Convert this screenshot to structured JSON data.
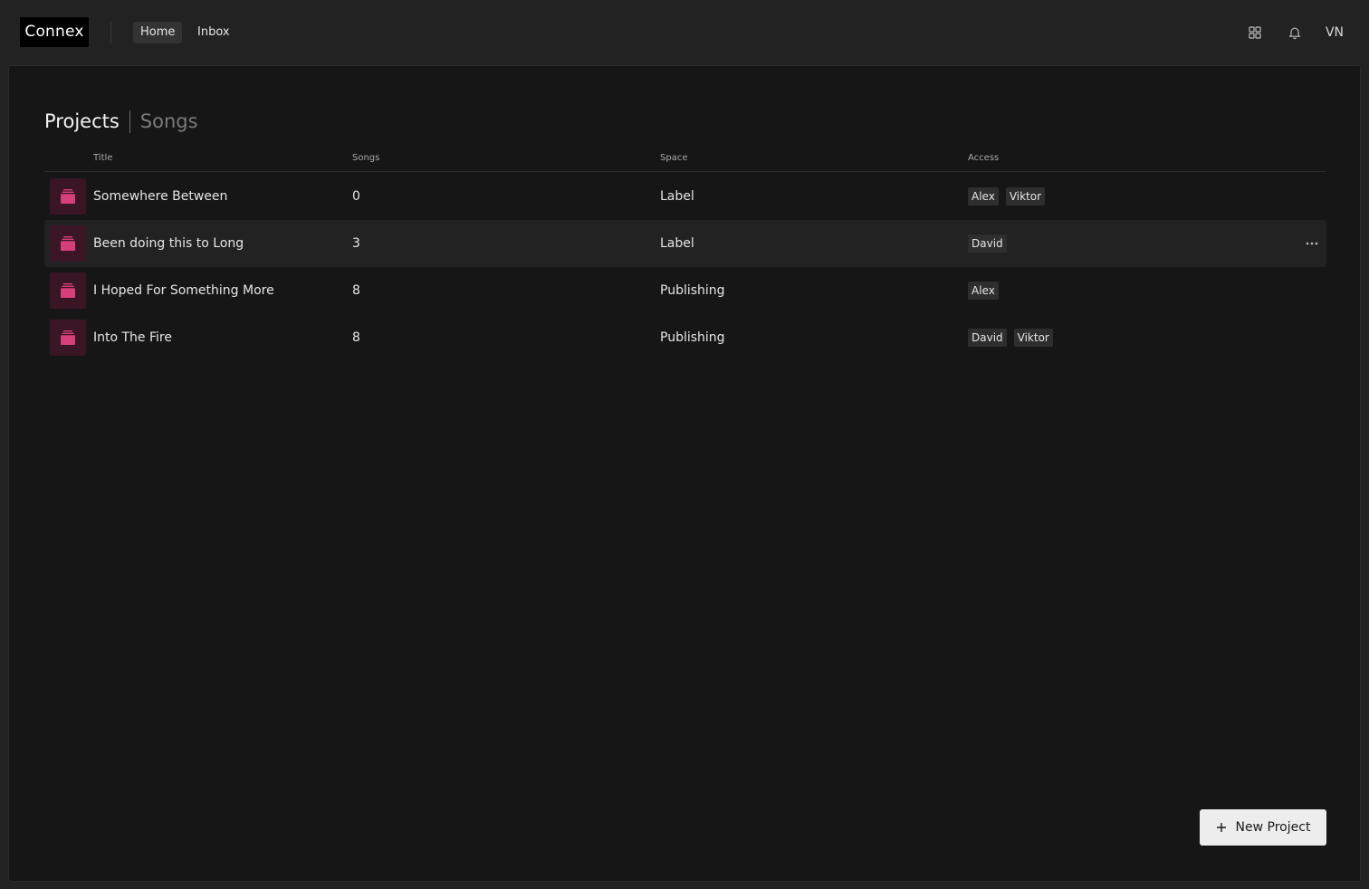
{
  "app": {
    "logo": "Connex"
  },
  "nav": [
    {
      "label": "Home",
      "active": true
    },
    {
      "label": "Inbox",
      "active": false
    }
  ],
  "header_icons": [
    "grid-icon",
    "bell-icon"
  ],
  "user": {
    "initials": "VN"
  },
  "tabs": [
    {
      "label": "Projects",
      "active": true
    },
    {
      "label": "Songs",
      "active": false
    }
  ],
  "table": {
    "columns": [
      "Title",
      "Songs",
      "Space",
      "Access"
    ],
    "rows": [
      {
        "title": "Somewhere Between",
        "songs": "0",
        "space": "Label",
        "access": [
          "Alex",
          "Viktor"
        ]
      },
      {
        "title": "Been doing this to Long",
        "songs": "3",
        "space": "Label",
        "access": [
          "David"
        ],
        "hovered": true
      },
      {
        "title": "I Hoped For Something More",
        "songs": "8",
        "space": "Publishing",
        "access": [
          "Alex"
        ]
      },
      {
        "title": "Into The Fire",
        "songs": "8",
        "space": "Publishing",
        "access": [
          "David",
          "Viktor"
        ]
      }
    ]
  },
  "actions": {
    "new_project_label": "New Project"
  },
  "colors": {
    "accent": "#d63f79",
    "thumb_bg": "#3a1524",
    "background": "#161616"
  }
}
